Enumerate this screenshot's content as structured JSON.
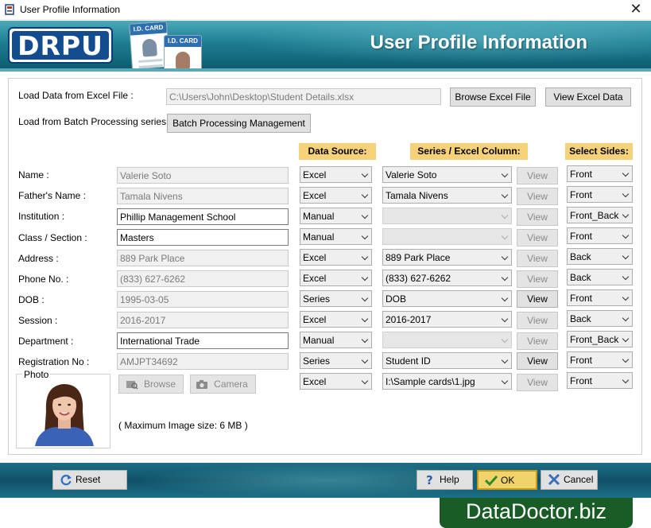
{
  "window": {
    "title": "User Profile Information",
    "close_glyph": "✕"
  },
  "banner": {
    "logo": "DRPU",
    "card_text": "I.D. CARD",
    "title": "User Profile Information"
  },
  "excel": {
    "label": "Load Data from Excel File :",
    "path": "C:\\Users\\John\\Desktop\\Student Details.xlsx",
    "browse_btn": "Browse Excel File",
    "view_btn": "View Excel Data"
  },
  "batch": {
    "label": "Load from Batch Processing series :",
    "btn": "Batch Processing Management"
  },
  "headers": {
    "data_source": "Data Source:",
    "series_column": "Series / Excel Column:",
    "select_sides": "Select Sides:"
  },
  "view_label": "View",
  "rows": [
    {
      "label": "Name :",
      "value": "Valerie Soto",
      "source": "Excel",
      "column": "Valerie Soto",
      "side": "Front"
    },
    {
      "label": "Father's Name :",
      "value": "Tamala Nivens",
      "source": "Excel",
      "column": "Tamala Nivens",
      "side": "Front"
    },
    {
      "label": "Institution :",
      "value": "Phillip Management School",
      "source": "Manual",
      "column": "",
      "side": "Front_Back"
    },
    {
      "label": "Class / Section :",
      "value": "Masters",
      "source": "Manual",
      "column": "",
      "side": "Front"
    },
    {
      "label": "Address :",
      "value": "889 Park Place",
      "source": "Excel",
      "column": "889 Park Place",
      "side": "Back"
    },
    {
      "label": "Phone No. :",
      "value": "(833) 627-6262",
      "source": "Excel",
      "column": "(833) 627-6262",
      "side": "Back"
    },
    {
      "label": "DOB :",
      "value": "1995-03-05",
      "source": "Series",
      "column": "DOB",
      "side": "Front"
    },
    {
      "label": "Session :",
      "value": "2016-2017",
      "source": "Excel",
      "column": "2016-2017",
      "side": "Back"
    },
    {
      "label": "Department :",
      "value": "International Trade",
      "source": "Manual",
      "column": "",
      "side": "Front_Back"
    },
    {
      "label": "Registration No :",
      "value": "AMJPT34692",
      "source": "Series",
      "column": "Student ID",
      "side": "Front"
    }
  ],
  "photo": {
    "label": "Photo",
    "browse_btn": "Browse",
    "camera_btn": "Camera",
    "source": "Excel",
    "column": "I:\\Sample cards\\1.jpg",
    "side": "Front",
    "max_size_note": "( Maximum Image size: 6 MB )"
  },
  "footer": {
    "reset": "Reset",
    "help": "Help",
    "ok": "OK",
    "cancel": "Cancel"
  },
  "brand": "DataDoctor.biz",
  "colors": {
    "header_bg": "#f5d27a",
    "banner": "#1e7e93",
    "ok_bg": "#f1d36b",
    "brand_bg": "#1a5c25"
  }
}
